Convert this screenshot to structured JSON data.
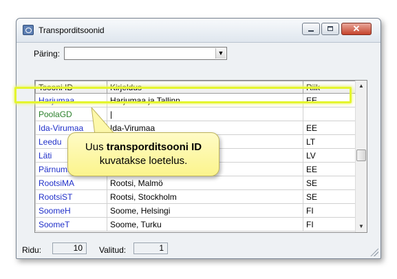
{
  "window": {
    "title": "Transporditsoonid"
  },
  "query": {
    "label": "Päring:",
    "value": ""
  },
  "table": {
    "headers": [
      "Tsooni ID",
      "Kirjeldus",
      "Riik"
    ],
    "rows": [
      {
        "id": "Harjumaa",
        "desc": "Harjumaa ja Tallinn",
        "country": "EE"
      },
      {
        "id": "PoolaGD",
        "desc": "",
        "country": ""
      },
      {
        "id": "Ida-Virumaa",
        "desc": "Ida-Virumaa",
        "country": "EE"
      },
      {
        "id": "Leedu",
        "desc": "",
        "country": "LT"
      },
      {
        "id": "Läti",
        "desc": "",
        "country": "LV"
      },
      {
        "id": "Pärnumaa",
        "desc": "",
        "country": "EE"
      },
      {
        "id": "RootsiMA",
        "desc": "Rootsi, Malmö",
        "country": "SE"
      },
      {
        "id": "RootsiST",
        "desc": "Rootsi, Stockholm",
        "country": "SE"
      },
      {
        "id": "SoomeH",
        "desc": "Soome, Helsingi",
        "country": "FI"
      },
      {
        "id": "SoomeT",
        "desc": "Soome, Turku",
        "country": "FI"
      }
    ]
  },
  "callout": {
    "line1_prefix": "Uus ",
    "line1_bold": "transporditsooni ID",
    "line2": "kuvatakse loetelus."
  },
  "status": {
    "rows_label": "Ridu:",
    "rows_value": "10",
    "selected_label": "Valitud:",
    "selected_value": "1"
  },
  "colors": {
    "id_link": "#1f2fc9",
    "new_id": "#2a7f2a",
    "highlight": "#e4f52e",
    "callout_bg": "#fbf48c"
  }
}
